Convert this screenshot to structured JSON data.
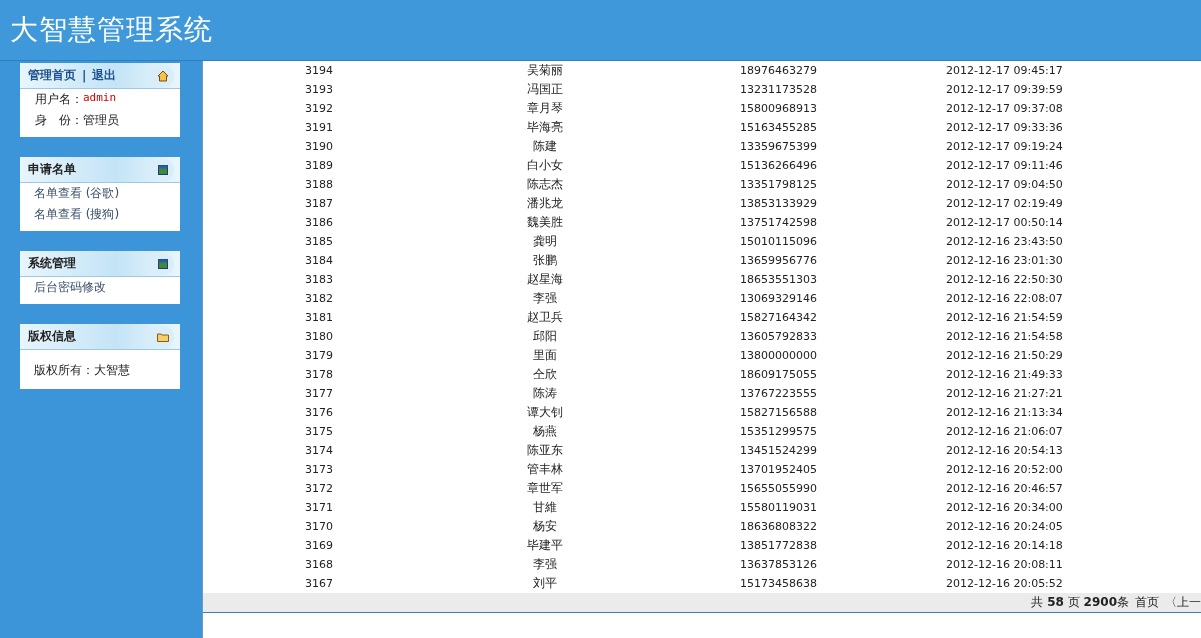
{
  "header": {
    "title": "大智慧管理系统"
  },
  "sidebar": {
    "panels": [
      {
        "kind": "account",
        "links": [
          "管理首页",
          "退出"
        ],
        "separator": "|",
        "fields": [
          {
            "label": "用户名：",
            "value": "admin"
          },
          {
            "label": "身　份：",
            "value": "管理员"
          }
        ]
      },
      {
        "kind": "menu",
        "title": "申请名单",
        "items": [
          "名单查看 (谷歌)",
          "名单查看 (搜狗)"
        ]
      },
      {
        "kind": "menu",
        "title": "系统管理",
        "items": [
          "后台密码修改"
        ]
      },
      {
        "kind": "info",
        "title": "版权信息",
        "text": "版权所有：大智慧"
      }
    ]
  },
  "table": {
    "rows": [
      {
        "id": "3194",
        "name": "吴菊丽",
        "phone": "18976463279",
        "time": "2012-12-17 09:45:17"
      },
      {
        "id": "3193",
        "name": "冯国正",
        "phone": "13231173528",
        "time": "2012-12-17 09:39:59"
      },
      {
        "id": "3192",
        "name": "章月琴",
        "phone": "15800968913",
        "time": "2012-12-17 09:37:08"
      },
      {
        "id": "3191",
        "name": "毕海亮",
        "phone": "15163455285",
        "time": "2012-12-17 09:33:36"
      },
      {
        "id": "3190",
        "name": "陈建",
        "phone": "13359675399",
        "time": "2012-12-17 09:19:24"
      },
      {
        "id": "3189",
        "name": "白小女",
        "phone": "15136266496",
        "time": "2012-12-17 09:11:46"
      },
      {
        "id": "3188",
        "name": "陈志杰",
        "phone": "13351798125",
        "time": "2012-12-17 09:04:50"
      },
      {
        "id": "3187",
        "name": "潘兆龙",
        "phone": "13853133929",
        "time": "2012-12-17 02:19:49"
      },
      {
        "id": "3186",
        "name": "魏美胜",
        "phone": "13751742598",
        "time": "2012-12-17 00:50:14"
      },
      {
        "id": "3185",
        "name": "龚明",
        "phone": "15010115096",
        "time": "2012-12-16 23:43:50"
      },
      {
        "id": "3184",
        "name": "张鹏",
        "phone": "13659956776",
        "time": "2012-12-16 23:01:30"
      },
      {
        "id": "3183",
        "name": "赵星海",
        "phone": "18653551303",
        "time": "2012-12-16 22:50:30"
      },
      {
        "id": "3182",
        "name": "李强",
        "phone": "13069329146",
        "time": "2012-12-16 22:08:07"
      },
      {
        "id": "3181",
        "name": "赵卫兵",
        "phone": "15827164342",
        "time": "2012-12-16 21:54:59"
      },
      {
        "id": "3180",
        "name": "邱阳",
        "phone": "13605792833",
        "time": "2012-12-16 21:54:58"
      },
      {
        "id": "3179",
        "name": "里面",
        "phone": "13800000000",
        "time": "2012-12-16 21:50:29"
      },
      {
        "id": "3178",
        "name": "仝欣",
        "phone": "18609175055",
        "time": "2012-12-16 21:49:33"
      },
      {
        "id": "3177",
        "name": "陈涛",
        "phone": "13767223555",
        "time": "2012-12-16 21:27:21"
      },
      {
        "id": "3176",
        "name": "谭大钊",
        "phone": "15827156588",
        "time": "2012-12-16 21:13:34"
      },
      {
        "id": "3175",
        "name": "杨燕",
        "phone": "15351299575",
        "time": "2012-12-16 21:06:07"
      },
      {
        "id": "3174",
        "name": "陈亚东",
        "phone": "13451524299",
        "time": "2012-12-16 20:54:13"
      },
      {
        "id": "3173",
        "name": "管丰林",
        "phone": "13701952405",
        "time": "2012-12-16 20:52:00"
      },
      {
        "id": "3172",
        "name": "章世军",
        "phone": "15655055990",
        "time": "2012-12-16 20:46:57"
      },
      {
        "id": "3171",
        "name": "甘維",
        "phone": "15580119031",
        "time": "2012-12-16 20:34:00"
      },
      {
        "id": "3170",
        "name": "杨安",
        "phone": "18636808322",
        "time": "2012-12-16 20:24:05"
      },
      {
        "id": "3169",
        "name": "毕建平",
        "phone": "13851772838",
        "time": "2012-12-16 20:14:18"
      },
      {
        "id": "3168",
        "name": "李强",
        "phone": "13637853126",
        "time": "2012-12-16 20:08:11"
      },
      {
        "id": "3167",
        "name": "刘平",
        "phone": "15173458638",
        "time": "2012-12-16 20:05:52"
      }
    ]
  },
  "pager": {
    "summary": "共 **58** 页 **2900**条",
    "links": [
      "首页",
      "〈上一"
    ]
  }
}
